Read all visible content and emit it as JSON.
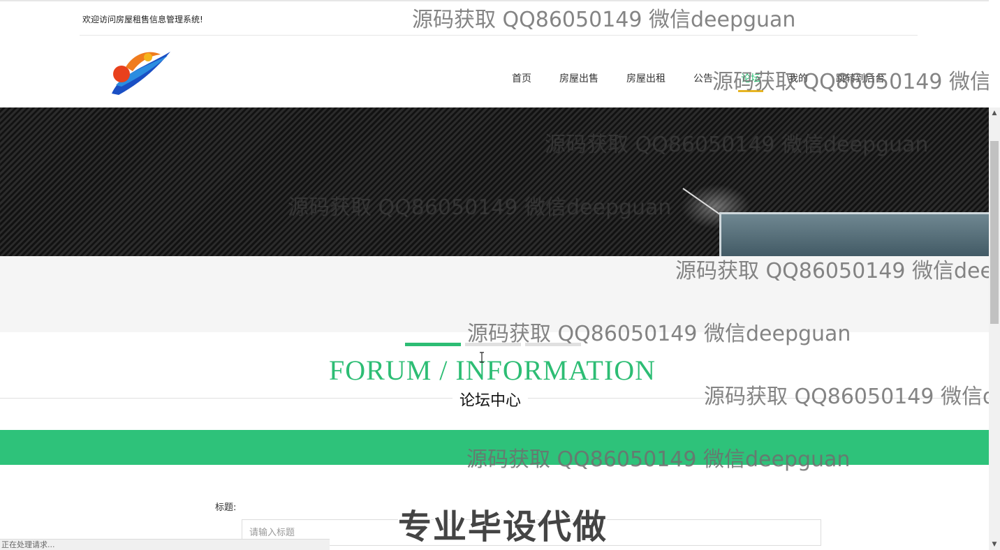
{
  "header": {
    "welcome": "欢迎访问房屋租售信息管理系统!"
  },
  "nav": {
    "items": [
      {
        "label": "首页"
      },
      {
        "label": "房屋出售"
      },
      {
        "label": "房屋出租"
      },
      {
        "label": "公告"
      },
      {
        "label": "论坛"
      },
      {
        "label": "我的"
      },
      {
        "label": "跳转到后台"
      }
    ],
    "active_index": 4
  },
  "section": {
    "title": "FORUM / INFORMATION",
    "subtitle": "论坛中心"
  },
  "form": {
    "title_label": "标题:",
    "title_placeholder": "请输入标题"
  },
  "status_bar": {
    "text": "正在处理请求..."
  },
  "watermarks": {
    "text": "源码获取 QQ86050149 微信deepguan",
    "promo": "专业毕设代做"
  },
  "colors": {
    "accent_green": "#2dbd74",
    "band_green": "#2ec27a",
    "active_underline": "#e6b422"
  }
}
